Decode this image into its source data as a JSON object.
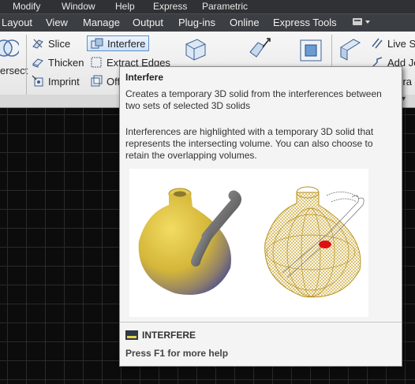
{
  "menubar": {
    "items": [
      "Modify",
      "Window",
      "Help",
      "Express",
      "Parametric"
    ]
  },
  "ribbon_tabs": {
    "items": [
      "Layout",
      "View",
      "Manage",
      "Output",
      "Plug-ins",
      "Online",
      "Express Tools"
    ]
  },
  "ribbon": {
    "left_panel_label": "ersect",
    "buttons": {
      "slice": "Slice",
      "thicken": "Thicken",
      "imprint": "Imprint",
      "interfere": "Interfere",
      "extract_edges": "Extract Edges",
      "offset": "Off",
      "live_section": "Live Se",
      "add_jog": "Add Jo",
      "generate": "nera"
    }
  },
  "tooltip": {
    "title": "Interfere",
    "description": "Creates a temporary 3D solid from the interferences between two sets of selected 3D solids",
    "detail": "Interferences are highlighted with a temporary 3D solid that represents the intersecting volume. You can also choose to retain the overlapping volumes.",
    "command": "INTERFERE",
    "help": "Press F1 for more help"
  },
  "colors": {
    "menubar_bg": "#2f3134",
    "ribbon_bg": "#efefef",
    "canvas_bg": "#0c0c0c",
    "tooltip_bg": "#f4f4f4",
    "solid_yellow": "#d9bf3c",
    "interference_red": "#e01010"
  },
  "icons": [
    "interfere-icon",
    "slice-icon",
    "thicken-icon",
    "imprint-icon",
    "extract-edges-icon",
    "offset-edges-icon",
    "command-line-icon",
    "tab-dropdown-icon"
  ]
}
